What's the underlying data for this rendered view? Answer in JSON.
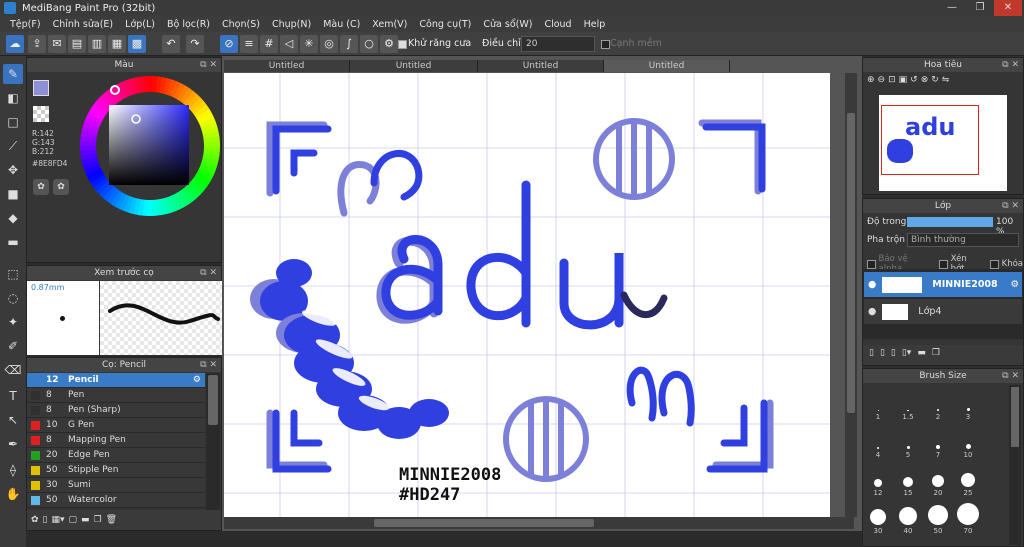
{
  "window": {
    "title": "MediBang Paint Pro (32bit)",
    "minimize": "—",
    "maximize": "❐",
    "close": "✕"
  },
  "menu": [
    "Tệp(F)",
    "Chỉnh sửa(E)",
    "Lớp(L)",
    "Bộ lọc(R)",
    "Chọn(S)",
    "Chụp(N)",
    "Màu (C)",
    "Xem(V)",
    "Công cụ(T)",
    "Cửa sổ(W)",
    "Cloud",
    "Help"
  ],
  "toolbar": {
    "antialias_label": "Khử răng cưa",
    "adjust_label": "Điều chỉnh",
    "adjust_value": "20",
    "edge_label": "Cạnh mềm"
  },
  "tabs": [
    "Untitled",
    "Untitled",
    "Untitled",
    "Untitled"
  ],
  "color_panel": {
    "title": "Màu",
    "r": "R:142",
    "g": "G:143",
    "b": "B:212",
    "hex": "#8E8FD4",
    "primary": "#8e8fd4",
    "secondary": "#c01818"
  },
  "preview_panel": {
    "title": "Xem trước cọ",
    "size": "0.87mm"
  },
  "brush_panel": {
    "title": "Cọ: Pencil",
    "items": [
      {
        "size": "12",
        "name": "Pencil",
        "color": "#3a7bc8"
      },
      {
        "size": "8",
        "name": "Pen",
        "color": "#303030"
      },
      {
        "size": "8",
        "name": "Pen (Sharp)",
        "color": "#303030"
      },
      {
        "size": "10",
        "name": "G Pen",
        "color": "#e02020"
      },
      {
        "size": "8",
        "name": "Mapping Pen",
        "color": "#e02020"
      },
      {
        "size": "20",
        "name": "Edge Pen",
        "color": "#22a022"
      },
      {
        "size": "50",
        "name": "Stipple Pen",
        "color": "#e0c000"
      },
      {
        "size": "30",
        "name": "Sumi",
        "color": "#e0c000"
      },
      {
        "size": "50",
        "name": "Watercolor",
        "color": "#60b8e8"
      }
    ]
  },
  "navigator": {
    "title": "Hoa tiêu"
  },
  "layer_panel": {
    "title": "Lớp",
    "opacity_label": "Độ trong",
    "opacity_value": "100 %",
    "blend_label": "Pha trộn",
    "blend_value": "Bình thường",
    "protect_alpha": "Bảo vệ alpha",
    "clipping": "Xén bớt",
    "lock": "Khóa",
    "layers": [
      {
        "name": "MINNIE2008"
      },
      {
        "name": "Lớp4"
      }
    ]
  },
  "brush_size": {
    "title": "Brush Size",
    "sizes": [
      "1",
      "1.5",
      "2",
      "3",
      "4",
      "5",
      "7",
      "10",
      "12",
      "15",
      "20",
      "25",
      "30",
      "40",
      "50",
      "70"
    ]
  },
  "artwork": {
    "main_text": "adu",
    "signature_line1": "MINNIE2008",
    "signature_line2": "#HD247",
    "stroke": "#2f3fe0",
    "shadow": "#7d80d8",
    "dark": "#2a2a5a",
    "thumb_text": "adu"
  }
}
